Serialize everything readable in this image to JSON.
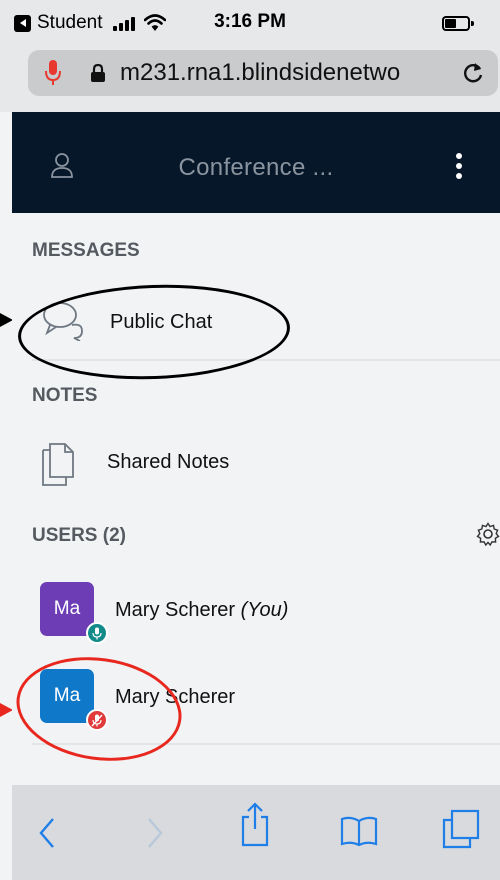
{
  "status_bar": {
    "back_app_label": "Student",
    "time": "3:16 PM"
  },
  "browser": {
    "url": "m231.rna1.blindsidenetwo"
  },
  "header": {
    "title": "Conference ..."
  },
  "messages": {
    "section_title": "MESSAGES",
    "public_chat_label": "Public Chat"
  },
  "notes": {
    "section_title": "NOTES",
    "shared_notes_label": "Shared Notes"
  },
  "users": {
    "section_title": "USERS (2)",
    "list": [
      {
        "initials": "Ma",
        "name": "Mary Scherer",
        "suffix": "(You)",
        "avatar_color": "#6c3db5",
        "mic_status": "unmuted",
        "status_color": "#128a8a"
      },
      {
        "initials": "Ma",
        "name": "Mary Scherer",
        "suffix": "",
        "avatar_color": "#0f78c8",
        "mic_status": "muted",
        "status_color": "#e03a3a"
      }
    ]
  },
  "annotations": {
    "black_ellipse_color": "#000000",
    "red_ellipse_color": "#e8281e"
  },
  "colors": {
    "header_bg": "#06172a",
    "accent_blue": "#1f7ee8",
    "mic_red": "#e8392f"
  }
}
